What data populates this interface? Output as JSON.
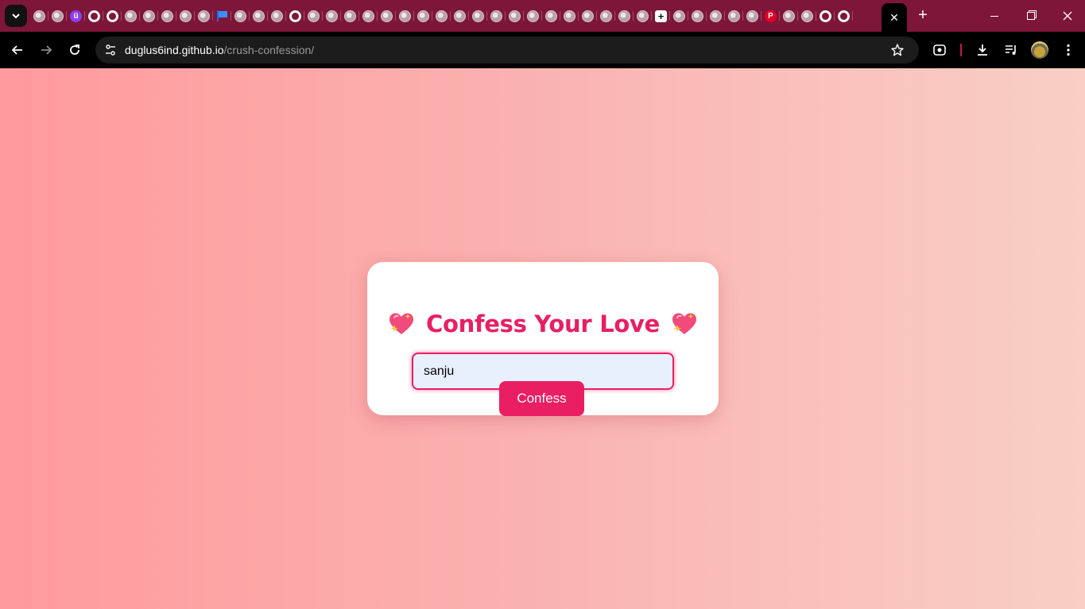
{
  "browser": {
    "tab_favicons": [
      "globe",
      "globe",
      "u",
      "github",
      "github",
      "globe",
      "globe",
      "globe",
      "globe",
      "globe",
      "flag",
      "globe",
      "globe",
      "globe",
      "github",
      "globe",
      "globe",
      "globe",
      "globe",
      "globe",
      "globe",
      "globe",
      "globe",
      "globe",
      "globe",
      "globe",
      "globe",
      "globe",
      "globe",
      "globe",
      "globe",
      "globe",
      "globe",
      "globe",
      "plus",
      "globe",
      "globe",
      "globe",
      "globe",
      "globe",
      "pinterest",
      "globe",
      "globe",
      "github",
      "github"
    ],
    "active_tab_close": "✕",
    "new_tab": "+",
    "address": {
      "host": "duglus6ind.github.io",
      "path": "/crush-confession/"
    },
    "theme_color": "#7d1639"
  },
  "page": {
    "background_from": "#ff9a9e",
    "background_to": "#f9cfc3",
    "accent": "#e91e63",
    "title": "Confess Your Love",
    "title_icon": "sparkling-heart-icon",
    "name_input": {
      "value": "sanju"
    },
    "confess_button": "Confess"
  }
}
